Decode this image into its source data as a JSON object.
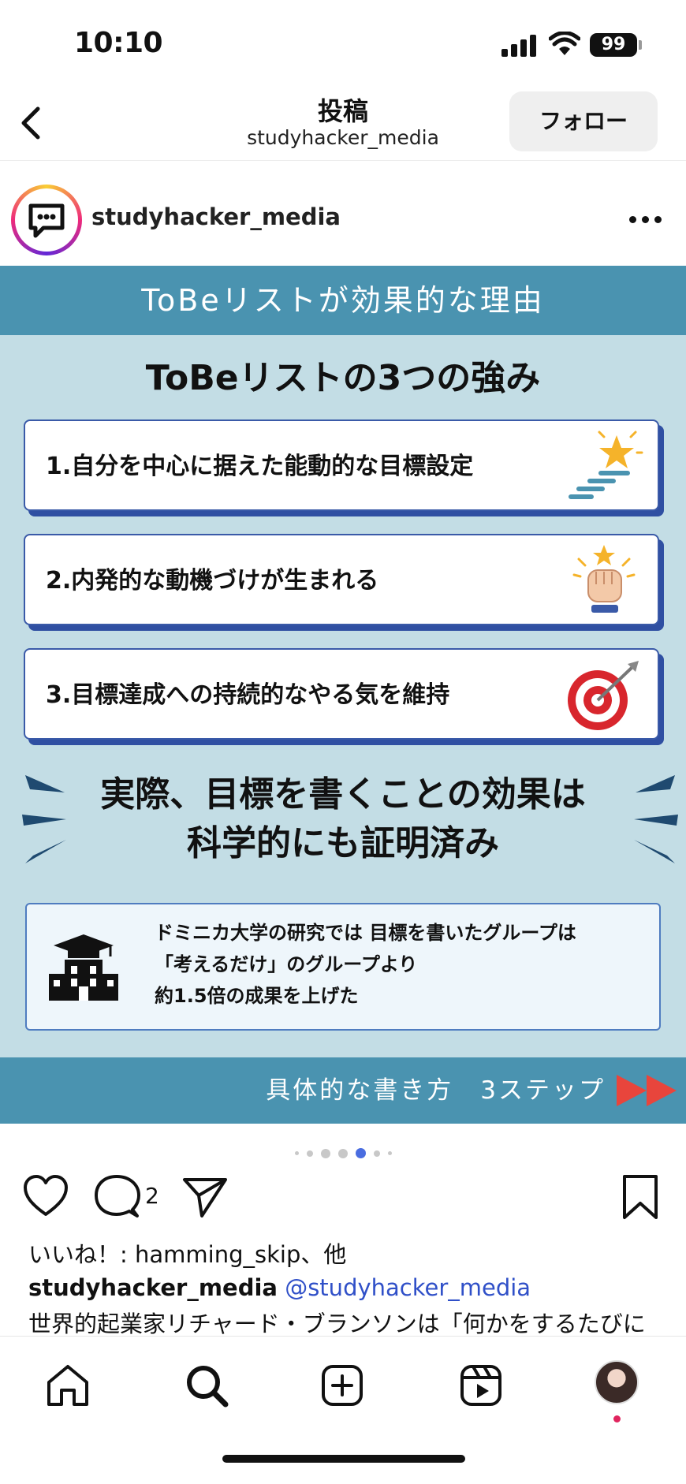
{
  "status_bar": {
    "time": "10:10",
    "battery": "99"
  },
  "nav": {
    "title": "投稿",
    "subtitle": "studyhacker_media",
    "follow_label": "フォロー"
  },
  "post": {
    "author": "studyhacker_media",
    "image": {
      "banner": "ToBeリストが効果的な理由",
      "heading": "ToBeリストの3つの強み",
      "strengths": [
        {
          "text": "1.自分を中心に据えた能動的な目標設定",
          "icon": "stairs-star-icon"
        },
        {
          "text": "2.内発的な動機づけが生まれる",
          "icon": "raised-fist-icon"
        },
        {
          "text": "3.目標達成への持続的なやる気を維持",
          "icon": "target-arrow-icon"
        }
      ],
      "claim_line1": "実際、目標を書くことの効果は",
      "claim_line2": "科学的にも証明済み",
      "research_line1": "ドミニカ大学の研究では 目標を書いたグループは",
      "research_line2": "「考えるだけ」のグループより",
      "research_line3": "約1.5倍の成果を上げた",
      "footer": "具体的な書き方　3ステップ"
    },
    "carousel": {
      "slide_count": 7,
      "active_index": 4
    },
    "comment_count": "2",
    "likes_text": "いいね！: hamming_skip、他",
    "caption_author": "studyhacker_media",
    "caption_mention": "@studyhacker_media",
    "caption_text": "世界的起業家リチャード・ブランソンは「何かをするたびに"
  },
  "colors": {
    "banner": "#4a93b0",
    "background": "#c3dde5",
    "card_shadow": "#2f4fa2",
    "mention": "#3050c8",
    "active_dot": "#4a6de0"
  }
}
